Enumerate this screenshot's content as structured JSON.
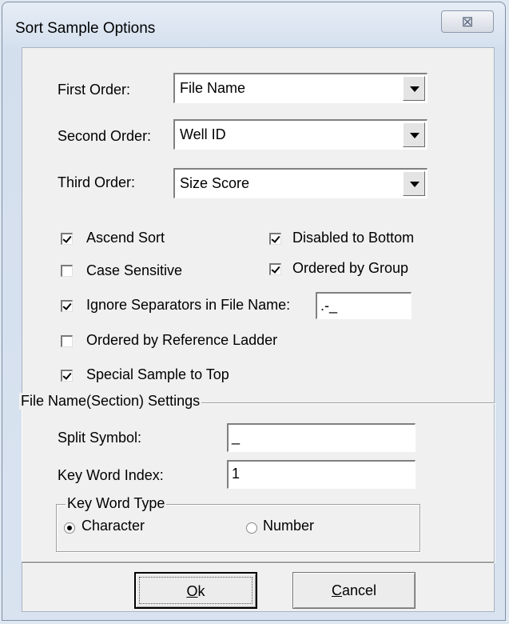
{
  "window": {
    "title": "Sort Sample Options",
    "close_glyph": "⊠"
  },
  "order": {
    "first_label": "First Order:",
    "first_value": "File Name",
    "second_label": "Second Order:",
    "second_value": "Well ID",
    "third_label": "Third Order:",
    "third_value": "Size Score"
  },
  "options": {
    "ascend_sort": {
      "label": "Ascend Sort",
      "checked": true
    },
    "disabled_to_bottom": {
      "label": "Disabled to Bottom",
      "checked": true
    },
    "case_sensitive": {
      "label": "Case Sensitive",
      "checked": false
    },
    "ordered_by_group": {
      "label": "Ordered by Group",
      "checked": true
    },
    "ignore_separators": {
      "label": "Ignore Separators in File Name:",
      "checked": true,
      "value": ".-_"
    },
    "ordered_by_reference_ladder": {
      "label": "Ordered by Reference Ladder",
      "checked": false
    },
    "special_sample_to_top": {
      "label": "Special Sample to Top",
      "checked": true
    }
  },
  "file_name_settings": {
    "title": "File Name(Section) Settings",
    "split_symbol_label": "Split Symbol:",
    "split_symbol_value": "_",
    "key_word_index_label": "Key Word Index:",
    "key_word_index_value": "1",
    "key_word_type": {
      "title": "Key Word Type",
      "character_label": "Character",
      "number_label": "Number",
      "selected": "Character"
    }
  },
  "buttons": {
    "ok_label": "Ok",
    "ok_mnemonic": "O",
    "cancel_label": "Cancel",
    "cancel_mnemonic": "C"
  }
}
